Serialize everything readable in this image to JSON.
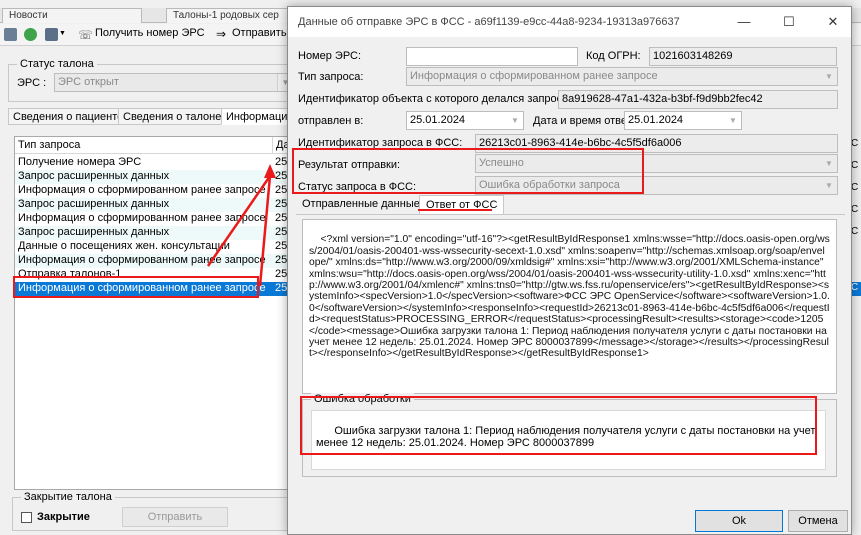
{
  "app": {
    "tabs": [
      {
        "label": "Новости"
      },
      {
        "label": "Талоны-1 родовых сер"
      }
    ],
    "toolbar": {
      "get_number_label": "Получить номер ЭРС",
      "send_label": "Отправить"
    },
    "status_group": {
      "title": "Статус талона",
      "ers_label": "ЭРС :",
      "ers_value": "ЭРС открыт"
    },
    "subtabs": [
      {
        "label": "Сведения о пациенте"
      },
      {
        "label": "Сведения о талоне"
      },
      {
        "label": "Информация"
      }
    ],
    "list": {
      "header": "Тип запроса",
      "header_col2": "Да",
      "rows": [
        {
          "type": "Получение номера ЭРС",
          "date": "25."
        },
        {
          "type": "Запрос расширенных данных",
          "date": "25."
        },
        {
          "type": "Информация о сформированном ранее запросе",
          "date": "25."
        },
        {
          "type": "Запрос расширенных данных",
          "date": "25."
        },
        {
          "type": "Информация о сформированном ранее запросе",
          "date": "25."
        },
        {
          "type": "Запрос расширенных данных",
          "date": "25."
        },
        {
          "type": "Данные о посещениях жен. консультации",
          "date": "25."
        },
        {
          "type": "Информация о сформированном ранее запросе",
          "date": "25."
        },
        {
          "type": "Отправка талонов-1",
          "date": "25."
        },
        {
          "type": "Информация о сформированном ранее запросе",
          "date": "25."
        }
      ]
    },
    "closing_group": {
      "title": "Закрытие талона",
      "checkbox_label": "Закрытие",
      "send_button": "Отправить"
    },
    "right_strip": [
      "С",
      "С",
      "С",
      "С",
      "С",
      "С"
    ]
  },
  "dialog": {
    "title": "Данные об отправке ЭРС в ФСС - a69f1139-e9cc-44a8-9234-19313a976637",
    "minimize": "—",
    "maximize": "☐",
    "close": "✕",
    "ers_number_label": "Номер ЭРС:",
    "ers_number_value": "",
    "ogrn_label": "Код ОГРН:",
    "ogrn_value": "1021603148269",
    "request_type_label": "Тип запроса:",
    "request_type_value": "Информация о сформированном ранее запросе",
    "object_id_label": "Идентификатор объекта с которого делался запрос:",
    "object_id_value": "8a919628-47a1-432a-b3bf-f9d9bb2fec42",
    "sent_label": "отправлен в:",
    "sent_value": "25.01.2024",
    "response_dt_label": "Дата и время ответа:",
    "response_dt_value": "25.01.2024",
    "fss_request_id_label": "Идентификатор запроса в ФСС:",
    "fss_request_id_value": "26213c01-8963-414e-b6bc-4c5f5df6a006",
    "result_label": "Результат отправки:",
    "result_value": "Успешно",
    "fss_status_label": "Статус запроса в ФСС:",
    "fss_status_value": "Ошибка обработки запроса",
    "tabs": [
      {
        "label": "Отправленные данные"
      },
      {
        "label": "Ответ от ФСС"
      }
    ],
    "xml_response": "<?xml version=\"1.0\" encoding=\"utf-16\"?><getResultByIdResponse1 xmlns:wsse=\"http://docs.oasis-open.org/wss/2004/01/oasis-200401-wss-wssecurity-secext-1.0.xsd\" xmlns:soapenv=\"http://schemas.xmlsoap.org/soap/envelope/\" xmlns:ds=\"http://www.w3.org/2000/09/xmldsig#\" xmlns:xsi=\"http://www.w3.org/2001/XMLSchema-instance\" xmlns:wsu=\"http://docs.oasis-open.org/wss/2004/01/oasis-200401-wss-wssecurity-utility-1.0.xsd\" xmlns:xenc=\"http://www.w3.org/2001/04/xmlenc#\" xmlns:tns0=\"http://gtw.ws.fss.ru/openservice/ers\"><getResultByIdResponse><systemInfo><specVersion>1.0</specVersion><software>ФСС ЭРС OpenService</software><softwareVersion>1.0.0</softwareVersion></systemInfo><responseInfo><requestId>26213c01-8963-414e-b6bc-4c5f5df6a006</requestId><requestStatus>PROCESSING_ERROR</requestStatus><processingResult><results><storage><code>1205</code><message>Ошибка загрузки талона 1: Период наблюдения получателя услуги с даты постановки на учет менее 12 недель: 25.01.2024. Номер ЭРС 8000037899</message></storage></results></processingResult></responseInfo></getResultByIdResponse></getResultByIdResponse1>",
    "error_group_title": "Ошибка обработки",
    "error_text": "Ошибка загрузки талона 1: Период наблюдения получателя услуги с даты постановки на учет менее 12 недель: 25.01.2024. Номер ЭРС 8000037899",
    "ok_button": "Ok",
    "cancel_button": "Отмена"
  },
  "colors": {
    "annotation_red": "#ea1a1a",
    "selection_blue": "#0a78d7"
  }
}
